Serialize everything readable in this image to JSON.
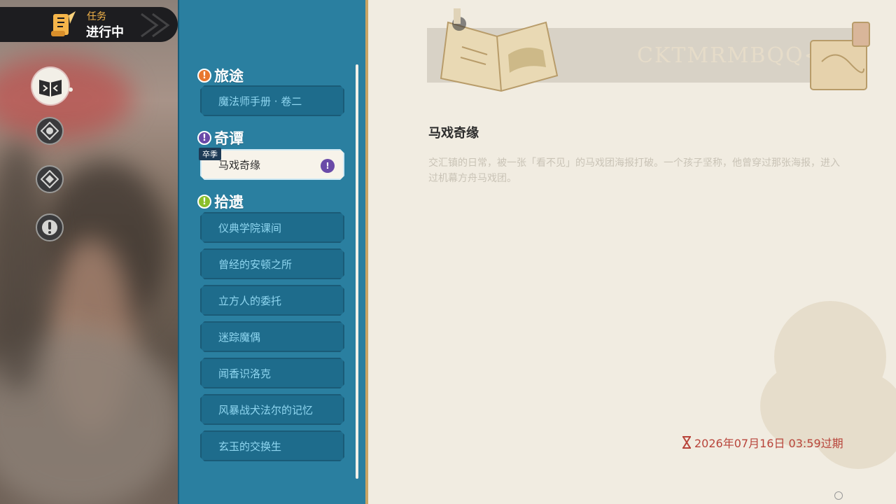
{
  "header": {
    "category": "任务",
    "status": "进行中"
  },
  "side_icons": [
    {
      "name": "book-icon",
      "active": true
    },
    {
      "name": "compass-icon",
      "active": false
    },
    {
      "name": "compass-alt-icon",
      "active": false
    },
    {
      "name": "exclamation-icon",
      "active": false
    }
  ],
  "list": {
    "groups": [
      {
        "label": "旅途",
        "badge": "!",
        "color": "#e8772e",
        "items": [
          {
            "label": "魔法师手册 · 卷二"
          }
        ]
      },
      {
        "label": "奇谭",
        "badge": "!",
        "color": "#6a4aa8",
        "items": [
          {
            "label": "马戏奇缘",
            "tag": "卒季",
            "selected": true
          }
        ]
      },
      {
        "label": "拾遗",
        "badge": "!",
        "color": "#8bbf2c",
        "items": [
          {
            "label": "仪典学院课间"
          },
          {
            "label": "曾经的安顿之所"
          },
          {
            "label": "立方人的委托"
          },
          {
            "label": "迷踪魔偶"
          },
          {
            "label": "闻香识洛克"
          },
          {
            "label": "风暴战犬法尔的记忆"
          },
          {
            "label": "玄玉的交换生"
          }
        ]
      }
    ]
  },
  "detail": {
    "banner_text": "CKTMRMBQQ<S",
    "title": "马戏奇缘",
    "description_line1": "交汇镇的日常，被一张「看不见」的马戏团海报打破。一个孩子坚称，他曾穿过那张海报，进入",
    "description_line2": "过机幕方舟马戏团。",
    "expiry": "2026年07月16日 03:59过期"
  },
  "colors": {
    "list_bg": "#2a7fa0",
    "item_bg": "#1e6c8c",
    "item_text": "#8fd6f0",
    "detail_bg": "#f1ece1",
    "expiry": "#b8443a"
  }
}
